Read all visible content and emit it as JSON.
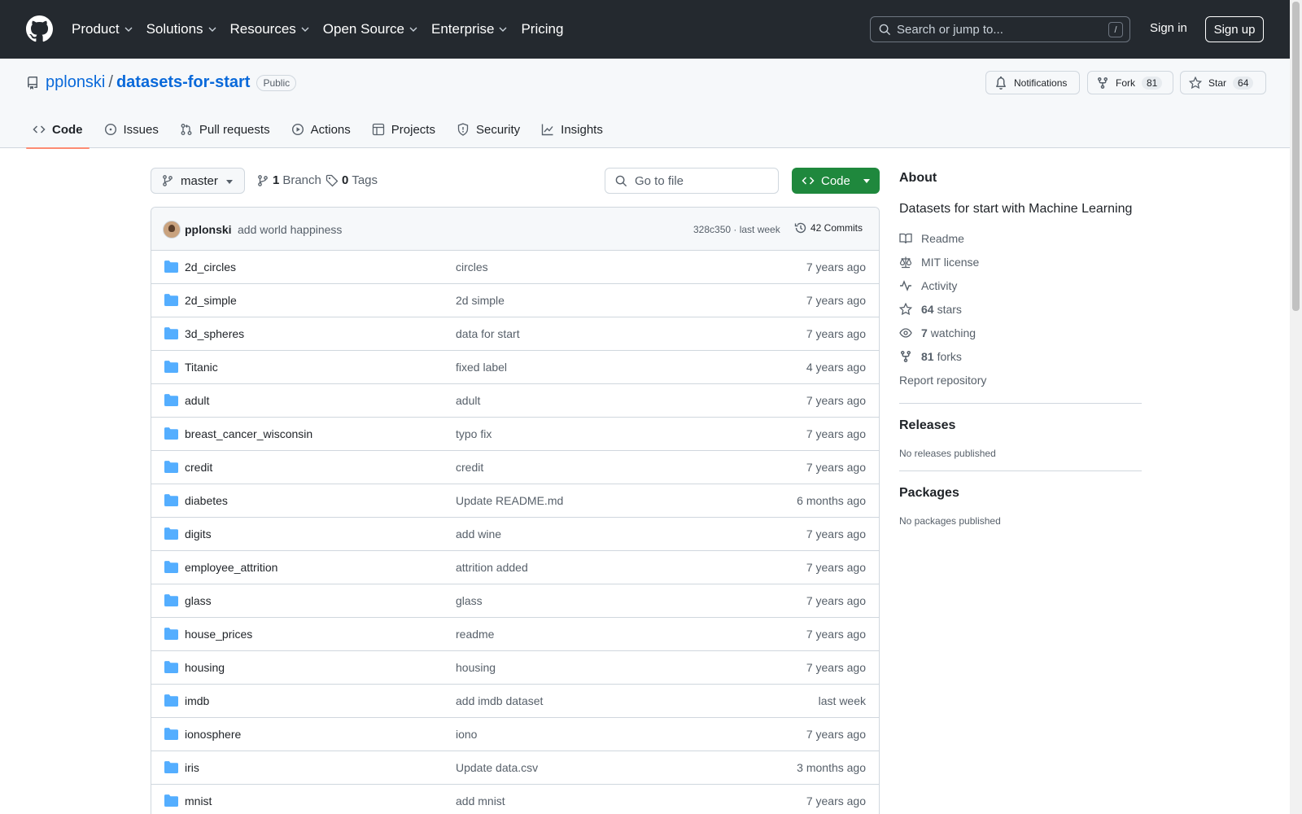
{
  "header": {
    "nav": [
      {
        "label": "Product",
        "has_menu": true
      },
      {
        "label": "Solutions",
        "has_menu": true
      },
      {
        "label": "Resources",
        "has_menu": true
      },
      {
        "label": "Open Source",
        "has_menu": true
      },
      {
        "label": "Enterprise",
        "has_menu": true
      },
      {
        "label": "Pricing",
        "has_menu": false
      }
    ],
    "search_placeholder": "Search or jump to...",
    "search_shortcut": "/",
    "sign_in": "Sign in",
    "sign_up": "Sign up"
  },
  "repo": {
    "owner": "pplonski",
    "separator": "/",
    "name": "datasets-for-start",
    "visibility": "Public",
    "notifications_label": "Notifications",
    "fork_label": "Fork",
    "fork_count": "81",
    "star_label": "Star",
    "star_count": "64"
  },
  "tabs": [
    {
      "label": "Code",
      "icon": "code-icon",
      "active": true
    },
    {
      "label": "Issues",
      "icon": "issue-icon",
      "active": false
    },
    {
      "label": "Pull requests",
      "icon": "pull-request-icon",
      "active": false
    },
    {
      "label": "Actions",
      "icon": "play-icon",
      "active": false
    },
    {
      "label": "Projects",
      "icon": "table-icon",
      "active": false
    },
    {
      "label": "Security",
      "icon": "shield-icon",
      "active": false
    },
    {
      "label": "Insights",
      "icon": "graph-icon",
      "active": false
    }
  ],
  "toolbar": {
    "branch": "master",
    "branch_count": "1",
    "branch_label": "Branch",
    "tag_count": "0",
    "tag_label": "Tags",
    "goto_placeholder": "Go to file",
    "code_button": "Code"
  },
  "latest_commit": {
    "author": "pplonski",
    "message": "add world happiness",
    "hash_time": "328c350 · last week",
    "commits_label": "42 Commits"
  },
  "files": [
    {
      "name": "2d_circles",
      "message": "circles",
      "age": "7 years ago"
    },
    {
      "name": "2d_simple",
      "message": "2d simple",
      "age": "7 years ago"
    },
    {
      "name": "3d_spheres",
      "message": "data for start",
      "age": "7 years ago"
    },
    {
      "name": "Titanic",
      "message": "fixed label",
      "age": "4 years ago"
    },
    {
      "name": "adult",
      "message": "adult",
      "age": "7 years ago"
    },
    {
      "name": "breast_cancer_wisconsin",
      "message": "typo fix",
      "age": "7 years ago"
    },
    {
      "name": "credit",
      "message": "credit",
      "age": "7 years ago"
    },
    {
      "name": "diabetes",
      "message": "Update README.md",
      "age": "6 months ago"
    },
    {
      "name": "digits",
      "message": "add wine",
      "age": "7 years ago"
    },
    {
      "name": "employee_attrition",
      "message": "attrition added",
      "age": "7 years ago"
    },
    {
      "name": "glass",
      "message": "glass",
      "age": "7 years ago"
    },
    {
      "name": "house_prices",
      "message": "readme",
      "age": "7 years ago"
    },
    {
      "name": "housing",
      "message": "housing",
      "age": "7 years ago"
    },
    {
      "name": "imdb",
      "message": "add imdb dataset",
      "age": "last week"
    },
    {
      "name": "ionosphere",
      "message": "iono",
      "age": "7 years ago"
    },
    {
      "name": "iris",
      "message": "Update data.csv",
      "age": "3 months ago"
    },
    {
      "name": "mnist",
      "message": "add mnist",
      "age": "7 years ago"
    }
  ],
  "about": {
    "title": "About",
    "description": "Datasets for start with Machine Learning",
    "readme": "Readme",
    "license": "MIT license",
    "activity": "Activity",
    "stars_count": "64",
    "stars_label": "stars",
    "watching_count": "7",
    "watching_label": "watching",
    "forks_count": "81",
    "forks_label": "forks",
    "report": "Report repository"
  },
  "releases": {
    "title": "Releases",
    "empty": "No releases published"
  },
  "packages": {
    "title": "Packages",
    "empty": "No packages published"
  },
  "colors": {
    "accent_link": "#0969da",
    "code_button": "#1f883d",
    "header_bg": "#24292f",
    "folder": "#54aeff",
    "active_tab": "#fd8c73"
  }
}
